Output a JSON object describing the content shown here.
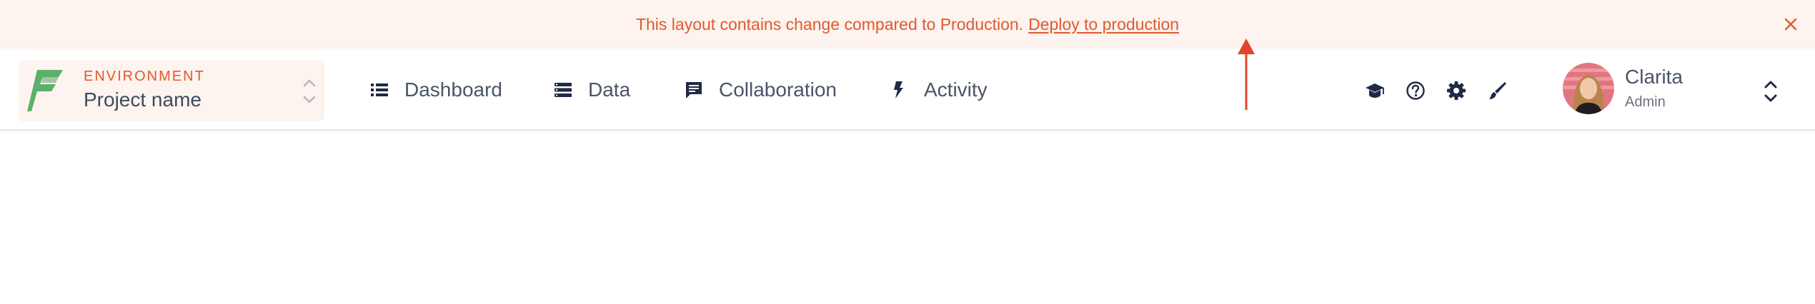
{
  "banner": {
    "message": "This layout contains change compared to Production.",
    "link_label": "Deploy to production",
    "close_icon": "close-icon",
    "text_color": "#e2592c",
    "background_color": "#fdf3ef"
  },
  "environment": {
    "label": "ENVIRONMENT",
    "project_name": "Project name",
    "logo_icon": "app-logo-icon",
    "chevron_icon": "chevron-up-down-icon"
  },
  "nav": {
    "items": [
      {
        "label": "Dashboard",
        "icon": "list-icon"
      },
      {
        "label": "Data",
        "icon": "database-icon"
      },
      {
        "label": "Collaboration",
        "icon": "comment-icon"
      },
      {
        "label": "Activity",
        "icon": "lightning-bolt-icon"
      }
    ]
  },
  "tools": [
    {
      "name": "learn",
      "icon": "graduation-cap-icon"
    },
    {
      "name": "help",
      "icon": "question-circle-icon"
    },
    {
      "name": "settings",
      "icon": "gear-icon"
    },
    {
      "name": "theme",
      "icon": "paint-brush-icon"
    }
  ],
  "user": {
    "name": "Clarita",
    "role": "Admin",
    "chevron_icon": "chevron-up-down-icon"
  },
  "colors": {
    "accent": "#e2592c",
    "logo_green": "#5bb06b",
    "nav_text": "#4a5568",
    "icon_dark": "#1f2a44"
  }
}
